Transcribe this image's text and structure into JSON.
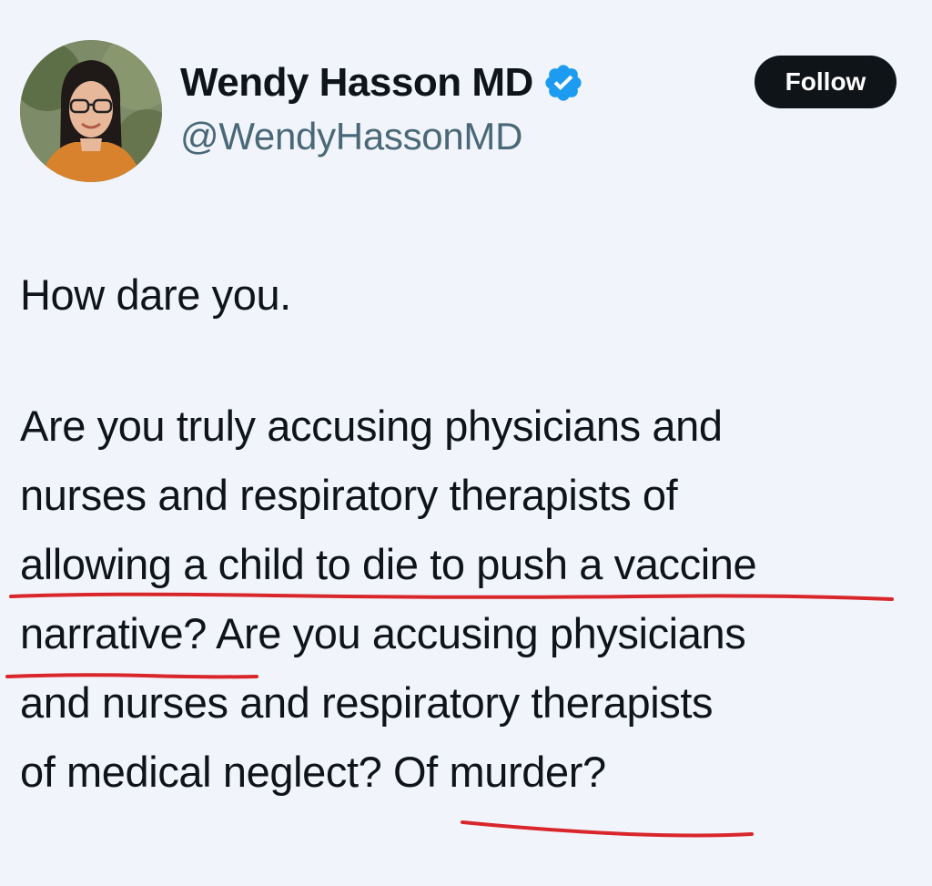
{
  "author": {
    "display_name": "Wendy Hasson MD",
    "handle": "@WendyHassonMD",
    "verified_icon": "verified-badge-icon",
    "verified_color": "#1d9bf0"
  },
  "follow_button": {
    "label": "Follow"
  },
  "tweet": {
    "lines": [
      "How dare you.",
      "Are you truly accusing physicians and",
      "nurses and respiratory therapists of",
      "allowing a child to die to push a vaccine",
      "narrative? Are you accusing physicians",
      "and nurses and respiratory therapists",
      "of medical neglect? Of murder?"
    ]
  },
  "annotations": {
    "underline_color": "#d8262b"
  }
}
